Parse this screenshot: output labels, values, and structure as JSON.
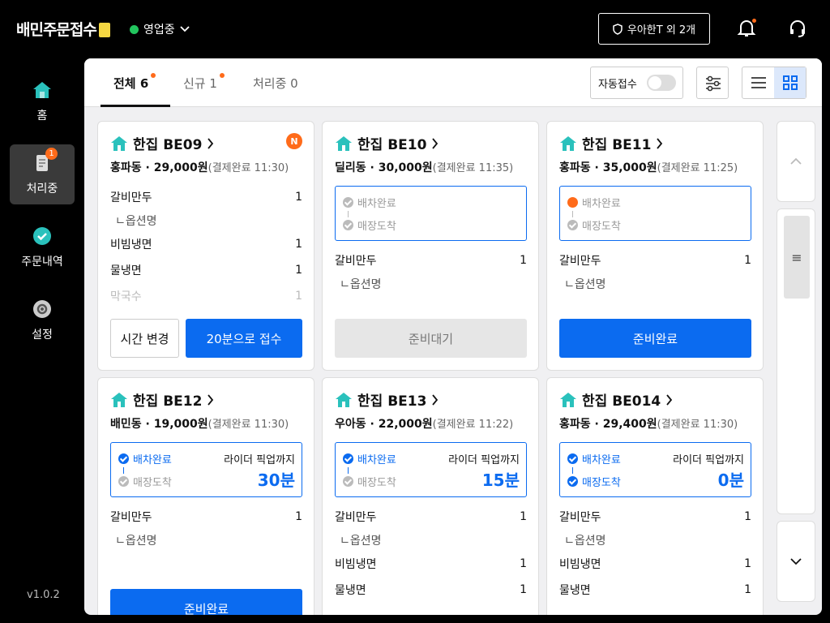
{
  "header": {
    "logo": "배민주문접수",
    "status": "영업중",
    "store_button": "우아한T 외 2개"
  },
  "sidebar": {
    "items": [
      {
        "label": "홈"
      },
      {
        "label": "처리중",
        "badge": "1"
      },
      {
        "label": "주문내역"
      },
      {
        "label": "설정"
      }
    ],
    "version": "v1.0.2"
  },
  "tabs": [
    {
      "label": "전체 6"
    },
    {
      "label": "신규 1"
    },
    {
      "label": "처리중 0"
    }
  ],
  "auto_accept": {
    "label": "자동접수",
    "on": false
  },
  "orders": [
    {
      "store": "한집 BE09",
      "new_badge": "N",
      "area": "홍파동 · 29,000원",
      "paid": "(결제완료 11:30)",
      "items": [
        {
          "name": "갈비만두",
          "qty": "1"
        },
        {
          "name": "ㄴ옵션명",
          "qty": ""
        },
        {
          "name": "비빔냉면",
          "qty": "1"
        },
        {
          "name": "물냉면",
          "qty": "1"
        },
        {
          "name": "막국수",
          "qty": "1"
        }
      ],
      "buttons": [
        "시간 변경",
        "20분으로 접수"
      ]
    },
    {
      "store": "한집 BE10",
      "area": "딜리동 · 30,000원",
      "paid": "(결제완료 11:35)",
      "status": [
        "배차완료",
        "매장도착"
      ],
      "items": [
        {
          "name": "갈비만두",
          "qty": "1"
        },
        {
          "name": "ㄴ옵션명",
          "qty": ""
        }
      ],
      "buttons": [
        "준비대기"
      ]
    },
    {
      "store": "한집 BE11",
      "area": "홍파동 · 35,000원",
      "paid": "(결제완료 11:25)",
      "status": [
        "배차완료",
        "매장도착"
      ],
      "items": [
        {
          "name": "갈비만두",
          "qty": "1"
        },
        {
          "name": "ㄴ옵션명",
          "qty": ""
        }
      ],
      "buttons": [
        "준비완료"
      ]
    },
    {
      "store": "한집 BE12",
      "area": "배민동 · 19,000원",
      "paid": "(결제완료 11:30)",
      "status": [
        "배차완료",
        "매장도착"
      ],
      "pickup_label": "라이더 픽업까지",
      "pickup_time": "30분",
      "items": [
        {
          "name": "갈비만두",
          "qty": "1"
        },
        {
          "name": "ㄴ옵션명",
          "qty": ""
        }
      ],
      "buttons": [
        "준비완료"
      ]
    },
    {
      "store": "한집 BE13",
      "area": "우아동 · 22,000원",
      "paid": "(결제완료 11:22)",
      "status": [
        "배차완료",
        "매장도착"
      ],
      "pickup_label": "라이더 픽업까지",
      "pickup_time": "15분",
      "items": [
        {
          "name": "갈비만두",
          "qty": "1"
        },
        {
          "name": "ㄴ옵션명",
          "qty": ""
        },
        {
          "name": "비빔냉면",
          "qty": "1"
        },
        {
          "name": "물냉면",
          "qty": "1"
        }
      ]
    },
    {
      "store": "한집 BE014",
      "area": "홍파동 · 29,400원",
      "paid": "(결제완료 11:30)",
      "status": [
        "배차완료",
        "매장도착"
      ],
      "pickup_label": "라이더 픽업까지",
      "pickup_time": "0분",
      "items": [
        {
          "name": "갈비만두",
          "qty": "1"
        },
        {
          "name": "ㄴ옵션명",
          "qty": ""
        },
        {
          "name": "비빔냉면",
          "qty": "1"
        },
        {
          "name": "물냉면",
          "qty": "1"
        }
      ]
    }
  ],
  "scroll_handle": "≡",
  "colors": {
    "accent": "#0b6bf0",
    "badge": "#ff6b1a",
    "status_on": "#22c55e"
  }
}
